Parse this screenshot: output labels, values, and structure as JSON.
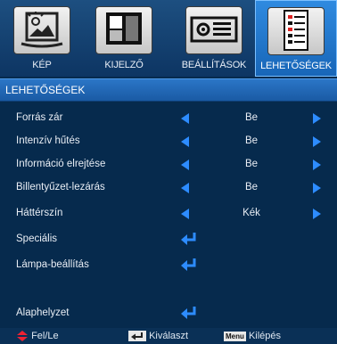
{
  "tabs": [
    {
      "label": "KÉP",
      "icon": "picture-icon"
    },
    {
      "label": "KIJELZŐ",
      "icon": "display-icon"
    },
    {
      "label": "BEÁLLÍTÁSOK",
      "icon": "projector-settings-icon"
    },
    {
      "label": "LEHETŐSÉGEK",
      "icon": "options-checklist-icon"
    }
  ],
  "section_title": "LEHETŐSÉGEK",
  "rows": [
    {
      "label": "Forrás zár",
      "value": "Be"
    },
    {
      "label": "Intenzív hűtés",
      "value": "Be"
    },
    {
      "label": "Információ elrejtése",
      "value": "Be"
    },
    {
      "label": "Billentyűzet-lezárás",
      "value": "Be"
    },
    {
      "label": "Háttérszín",
      "value": "Kék"
    },
    {
      "label": "Speciális"
    },
    {
      "label": "Lámpa-beállítás"
    },
    {
      "label": "Alaphelyzet"
    }
  ],
  "help": {
    "updown": "Fel/Le",
    "select": "Kiválaszt",
    "menu_key": "Menu",
    "exit": "Kilépés"
  },
  "colors": {
    "accent_arrow": "#2d8cff",
    "active_tab": "#1f74cc",
    "background": "#062a4d"
  }
}
